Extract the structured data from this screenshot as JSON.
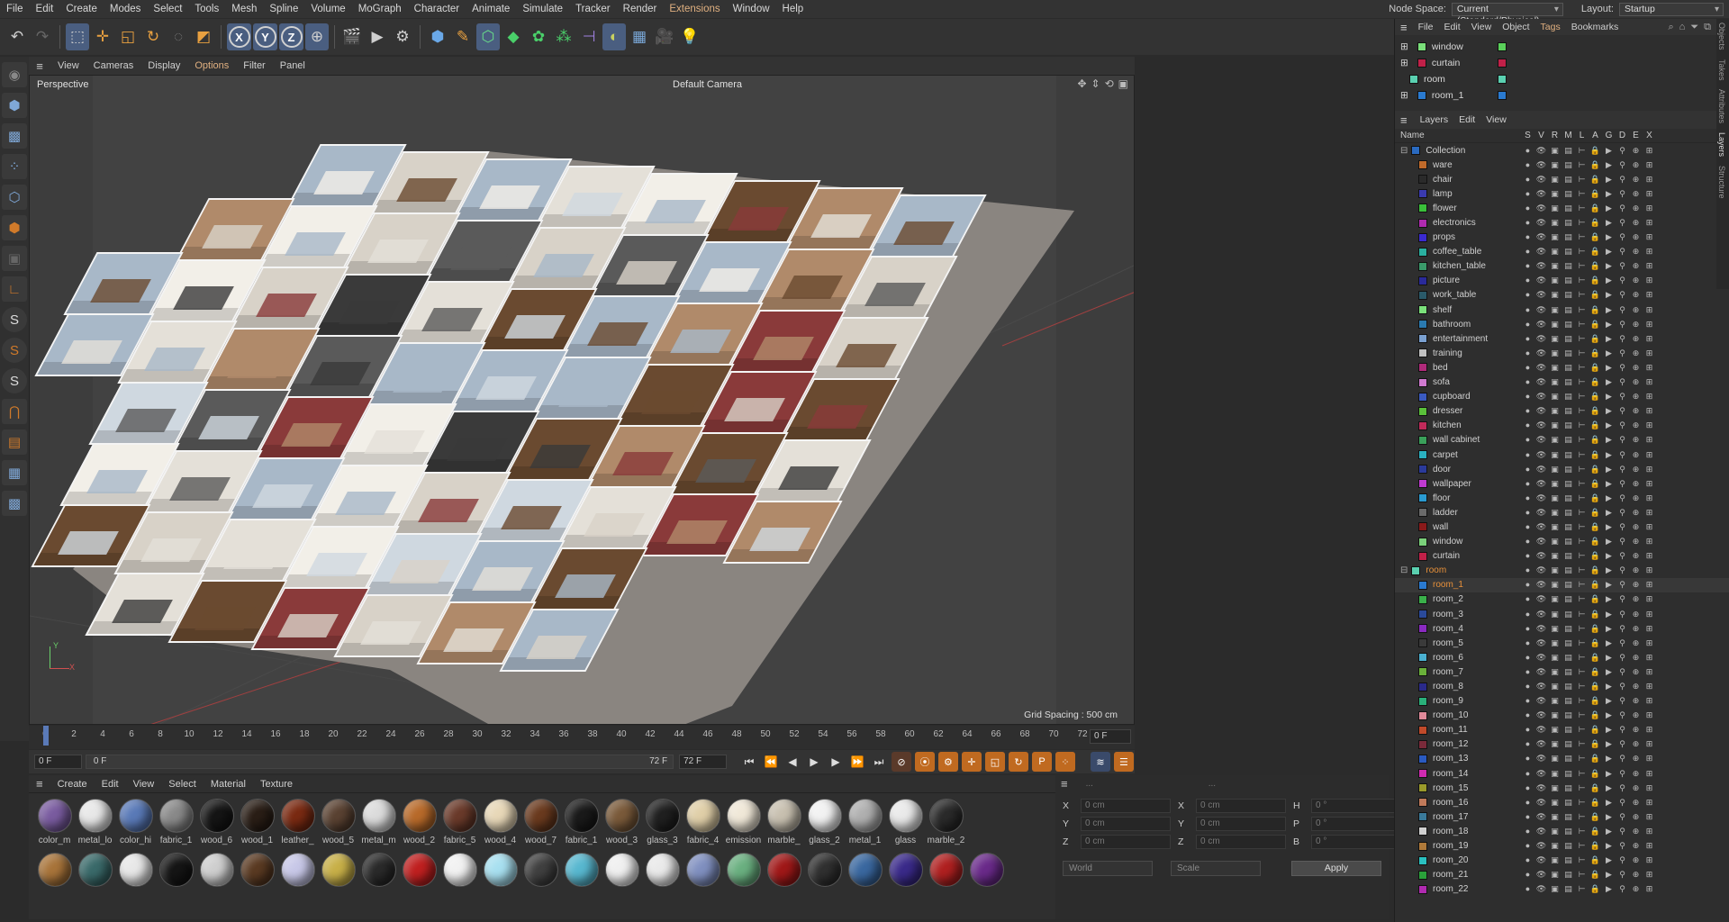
{
  "menubar": {
    "items": [
      "File",
      "Edit",
      "Create",
      "Modes",
      "Select",
      "Tools",
      "Mesh",
      "Spline",
      "Volume",
      "MoGraph",
      "Character",
      "Animate",
      "Simulate",
      "Tracker",
      "Render",
      "Extensions",
      "Window",
      "Help"
    ],
    "node_space_label": "Node Space:",
    "node_space_value": "Current (Standard/Physical)",
    "layout_label": "Layout:",
    "layout_value": "Startup"
  },
  "viewport": {
    "menu": [
      "View",
      "Cameras",
      "Display",
      "Options",
      "Filter",
      "Panel"
    ],
    "projection": "Perspective",
    "camera": "Default Camera",
    "grid_spacing": "Grid Spacing : 500 cm"
  },
  "timeline": {
    "ticks": [
      "0",
      "2",
      "4",
      "6",
      "8",
      "10",
      "12",
      "14",
      "16",
      "18",
      "20",
      "22",
      "24",
      "26",
      "28",
      "30",
      "32",
      "34",
      "36",
      "38",
      "40",
      "42",
      "44",
      "46",
      "48",
      "50",
      "52",
      "54",
      "56",
      "58",
      "60",
      "62",
      "64",
      "66",
      "68",
      "70",
      "72"
    ],
    "current_frame": "0 F",
    "start_field": "0 F",
    "range_start": "0 F",
    "range_end": "72 F",
    "end_field": "72 F"
  },
  "materials": {
    "menu": [
      "Create",
      "Edit",
      "View",
      "Select",
      "Material",
      "Texture"
    ],
    "row1": [
      {
        "name": "color_m",
        "color": "#7a5ca0"
      },
      {
        "name": "metal_lo",
        "color": "#e8e8e8"
      },
      {
        "name": "color_hi",
        "color": "#5a7ab8"
      },
      {
        "name": "fabric_1",
        "color": "#8a8a8a"
      },
      {
        "name": "wood_6",
        "color": "#151515"
      },
      {
        "name": "wood_1",
        "color": "#2a1e16"
      },
      {
        "name": "leather_",
        "color": "#7a2a12"
      },
      {
        "name": "wood_5",
        "color": "#5a4232"
      },
      {
        "name": "metal_m",
        "color": "#dcdcdc"
      },
      {
        "name": "wood_2",
        "color": "#b86a2a"
      },
      {
        "name": "fabric_5",
        "color": "#6a3a2a"
      },
      {
        "name": "wood_4",
        "color": "#e8d8b8"
      },
      {
        "name": "wood_7",
        "color": "#6a3a1e"
      },
      {
        "name": "fabric_1",
        "color": "#1a1a1a"
      },
      {
        "name": "wood_3",
        "color": "#7a5a3a"
      },
      {
        "name": "glass_3",
        "color": "#202020"
      },
      {
        "name": "fabric_4",
        "color": "#e0cfa8"
      },
      {
        "name": "emission",
        "color": "#f0e8d8"
      },
      {
        "name": "marble_",
        "color": "#c8c0b0"
      },
      {
        "name": "glass_2",
        "color": "#f2f2f2"
      },
      {
        "name": "metal_1",
        "color": "#b0b0b0"
      },
      {
        "name": "glass",
        "color": "#eaeaea"
      },
      {
        "name": "marble_2",
        "color": "#2a2a2a"
      }
    ],
    "row2_colors": [
      "#a8743a",
      "#3a6a6a",
      "#e8e8e8",
      "#151515",
      "#cfcfcf",
      "#5a3a22",
      "#c8c8e8",
      "#c8b048",
      "#2a2a2a",
      "#c02020",
      "#f2f2f2",
      "#a8e0f0",
      "#404040",
      "#58b8d0",
      "#f0f0f0",
      "#eaeaea",
      "#8090c0",
      "#6ab080",
      "#a01818",
      "#303030",
      "#3a68a0",
      "#3a2a8a",
      "#b02020",
      "#6a2a8a"
    ]
  },
  "attributes": {
    "rows": [
      {
        "a": "X",
        "av": "0 cm",
        "b": "X",
        "bv": "0 cm",
        "c": "H",
        "cv": "0 °"
      },
      {
        "a": "Y",
        "av": "0 cm",
        "b": "Y",
        "bv": "0 cm",
        "c": "P",
        "cv": "0 °"
      },
      {
        "a": "Z",
        "av": "0 cm",
        "b": "Z",
        "bv": "0 cm",
        "c": "B",
        "cv": "0 °"
      }
    ],
    "coord_mode": "World",
    "scale_mode": "Scale",
    "apply": "Apply"
  },
  "objects": {
    "menu": [
      "File",
      "Edit",
      "View",
      "Object",
      "Tags",
      "Bookmarks"
    ],
    "rows": [
      {
        "name": "window",
        "color": "#7adf7a",
        "tag": "#5ad05a"
      },
      {
        "name": "curtain",
        "color": "#c02048",
        "tag": "#c02048"
      },
      {
        "name": "room",
        "color": "#5ad0b0",
        "tag": "#5ad0b0"
      },
      {
        "name": "room_1",
        "color": "#2a7ad0",
        "tag": "#2a7ad0"
      }
    ]
  },
  "layers": {
    "menu": [
      "Layers",
      "Edit",
      "View"
    ],
    "header_name": "Name",
    "columns": [
      "S",
      "V",
      "R",
      "M",
      "L",
      "A",
      "G",
      "D",
      "E",
      "X"
    ],
    "rows": [
      {
        "name": "Collection",
        "color": "#2a6ac0",
        "indent": 0
      },
      {
        "name": "ware",
        "color": "#c06a2a",
        "indent": 1
      },
      {
        "name": "chair",
        "color": "#2a2a2a",
        "indent": 1
      },
      {
        "name": "lamp",
        "color": "#3a3ab0",
        "indent": 1
      },
      {
        "name": "flower",
        "color": "#3ac03a",
        "indent": 1
      },
      {
        "name": "electronics",
        "color": "#b02ab0",
        "indent": 1
      },
      {
        "name": "props",
        "color": "#3a2ad0",
        "indent": 1
      },
      {
        "name": "coffee_table",
        "color": "#2ab0a0",
        "indent": 1
      },
      {
        "name": "kitchen_table",
        "color": "#3a9a6a",
        "indent": 1
      },
      {
        "name": "picture",
        "color": "#2a2a9a",
        "indent": 1
      },
      {
        "name": "work_table",
        "color": "#2a5a6a",
        "indent": 1
      },
      {
        "name": "shelf",
        "color": "#7ae07a",
        "indent": 1
      },
      {
        "name": "bathroom",
        "color": "#2a7ab0",
        "indent": 1
      },
      {
        "name": "entertainment",
        "color": "#7aa0d0",
        "indent": 1
      },
      {
        "name": "training",
        "color": "#c0c0c0",
        "indent": 1
      },
      {
        "name": "bed",
        "color": "#b02a7a",
        "indent": 1
      },
      {
        "name": "sofa",
        "color": "#d07ad0",
        "indent": 1
      },
      {
        "name": "cupboard",
        "color": "#3a5ac0",
        "indent": 1
      },
      {
        "name": "dresser",
        "color": "#5ac03a",
        "indent": 1
      },
      {
        "name": "kitchen",
        "color": "#c02a5a",
        "indent": 1
      },
      {
        "name": "wall cabinet",
        "color": "#3aa05a",
        "indent": 1
      },
      {
        "name": "carpet",
        "color": "#2ab0c0",
        "indent": 1
      },
      {
        "name": "door",
        "color": "#2a3a9a",
        "indent": 1
      },
      {
        "name": "wallpaper",
        "color": "#c03ad0",
        "indent": 1
      },
      {
        "name": "floor",
        "color": "#2a9ad0",
        "indent": 1
      },
      {
        "name": "ladder",
        "color": "#6a6a6a",
        "indent": 1
      },
      {
        "name": "wall",
        "color": "#8a1a1a",
        "indent": 1
      },
      {
        "name": "window",
        "color": "#7ad07a",
        "indent": 1
      },
      {
        "name": "curtain",
        "color": "#c02048",
        "indent": 1
      },
      {
        "name": "room",
        "color": "#5ad0b0",
        "indent": 0,
        "orange": true
      },
      {
        "name": "room_1",
        "color": "#2a7ad0",
        "indent": 1,
        "orange": true
      },
      {
        "name": "room_2",
        "color": "#3ab04a",
        "indent": 1
      },
      {
        "name": "room_3",
        "color": "#2a4a9a",
        "indent": 1
      },
      {
        "name": "room_4",
        "color": "#8a2ac0",
        "indent": 1
      },
      {
        "name": "room_5",
        "color": "#3a3a3a",
        "indent": 1
      },
      {
        "name": "room_6",
        "color": "#4ab0d0",
        "indent": 1
      },
      {
        "name": "room_7",
        "color": "#6ab03a",
        "indent": 1
      },
      {
        "name": "room_8",
        "color": "#2a2a8a",
        "indent": 1
      },
      {
        "name": "room_9",
        "color": "#2ab07a",
        "indent": 1
      },
      {
        "name": "room_10",
        "color": "#e08a9a",
        "indent": 1
      },
      {
        "name": "room_11",
        "color": "#c04a2a",
        "indent": 1
      },
      {
        "name": "room_12",
        "color": "#7a2a3a",
        "indent": 1
      },
      {
        "name": "room_13",
        "color": "#2a5ac0",
        "indent": 1
      },
      {
        "name": "room_14",
        "color": "#d02ab0",
        "indent": 1
      },
      {
        "name": "room_15",
        "color": "#9a9a2a",
        "indent": 1
      },
      {
        "name": "room_16",
        "color": "#c07a5a",
        "indent": 1
      },
      {
        "name": "room_17",
        "color": "#3a7a9a",
        "indent": 1
      },
      {
        "name": "room_18",
        "color": "#d0d0d0",
        "indent": 1
      },
      {
        "name": "room_19",
        "color": "#b07a3a",
        "indent": 1
      },
      {
        "name": "room_20",
        "color": "#2ac0c0",
        "indent": 1
      },
      {
        "name": "room_21",
        "color": "#2aa03a",
        "indent": 1
      },
      {
        "name": "room_22",
        "color": "#b02ab0",
        "indent": 1
      }
    ]
  },
  "side_tabs": [
    "Objects",
    "Takes",
    "Attributes",
    "Layers",
    "Structure"
  ],
  "icons": {
    "undo": "undo-icon",
    "redo": "redo-icon"
  }
}
